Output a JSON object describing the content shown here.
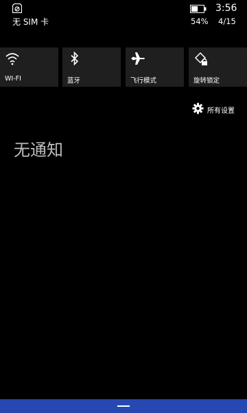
{
  "status_bar": {
    "carrier": "无 SIM 卡",
    "time": "3:56",
    "battery_percent": "54%",
    "battery_level": 0.54,
    "date": "4/15"
  },
  "quick_actions": [
    {
      "label": "WI-FI",
      "icon": "wifi-icon"
    },
    {
      "label": "蓝牙",
      "icon": "bluetooth-icon"
    },
    {
      "label": "飞行模式",
      "icon": "airplane-icon"
    },
    {
      "label": "旋转锁定",
      "icon": "rotation-lock-icon"
    }
  ],
  "all_settings": {
    "label": "所有设置",
    "icon": "gear-icon"
  },
  "notifications": {
    "empty_text": "无通知"
  },
  "colors": {
    "background": "#000000",
    "tile": "#1f1f1f",
    "accent_bar": "#2748b2",
    "empty_text": "#bdbdbd"
  }
}
